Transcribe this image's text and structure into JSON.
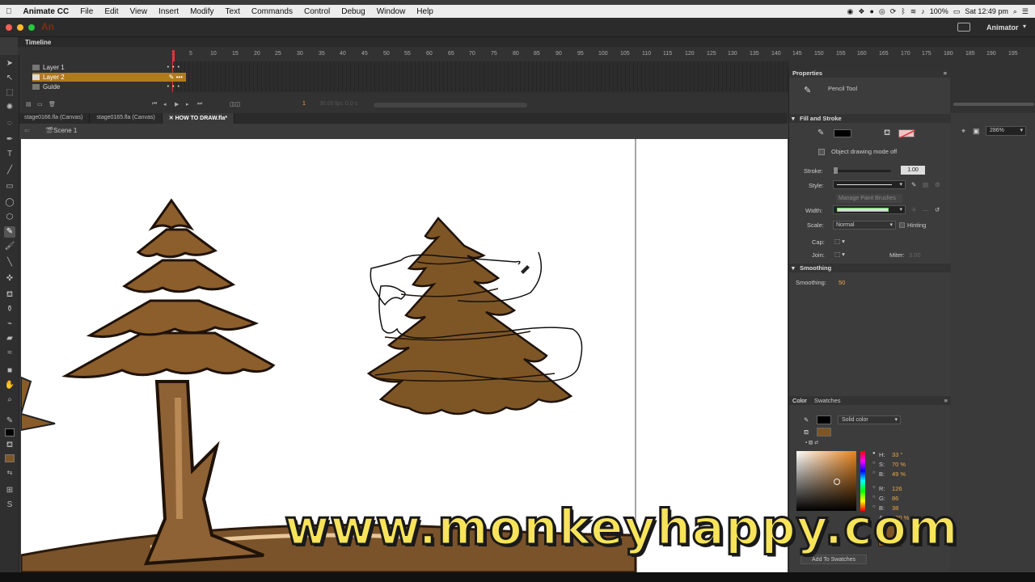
{
  "menubar": {
    "apple": "",
    "app_name": "Animate CC",
    "items": [
      "File",
      "Edit",
      "View",
      "Insert",
      "Modify",
      "Text",
      "Commands",
      "Control",
      "Debug",
      "Window",
      "Help"
    ],
    "battery": "100%",
    "clock": "Sat 12:49 pm"
  },
  "titlebar": {
    "logo": "An",
    "workspace": "Animator"
  },
  "timeline": {
    "title": "Timeline",
    "layers": [
      {
        "name": "Layer 1",
        "selected": false
      },
      {
        "name": "Layer 2",
        "selected": true
      },
      {
        "name": "Guide",
        "selected": false
      }
    ],
    "ruler_ticks": [
      "1",
      "5",
      "10",
      "15",
      "20",
      "25",
      "30",
      "35",
      "40",
      "45",
      "50",
      "55",
      "60",
      "65",
      "70",
      "75",
      "80",
      "85",
      "90",
      "95",
      "100",
      "105",
      "110",
      "115",
      "120",
      "125",
      "130",
      "135",
      "140",
      "145",
      "150",
      "155",
      "160",
      "165",
      "170",
      "175",
      "180",
      "185",
      "190",
      "195"
    ],
    "current_frame": "1",
    "fps": "30.00 fps",
    "time": "0.0 s"
  },
  "doc_tabs": [
    "stage0166.fla (Canvas)",
    "stage0165.fla (Canvas)",
    "HOW TO DRAW.fla*"
  ],
  "active_tab_index": 2,
  "scene": "Scene 1",
  "zoom": "286%",
  "properties": {
    "title": "Properties",
    "tool_name": "Pencil Tool",
    "fill_stroke_title": "Fill and Stroke",
    "object_drawing": "Object drawing mode off",
    "stroke_label": "Stroke:",
    "stroke_value": "1.00",
    "style_label": "Style:",
    "manage_brushes": "Manage Paint Brushes",
    "width_label": "Width:",
    "scale_label": "Scale:",
    "scale_value": "Normal",
    "hinting_label": "Hinting",
    "cap_label": "Cap:",
    "join_label": "Join:",
    "miter_label": "Miter:",
    "miter_value": "3.00",
    "smoothing_title": "Smoothing",
    "smoothing_label": "Smoothing:",
    "smoothing_value": "50"
  },
  "color_panel": {
    "tab_color": "Color",
    "tab_swatches": "Swatches",
    "type": "Solid color",
    "h_label": "H:",
    "h": "33 °",
    "s_label": "S:",
    "s": "70 %",
    "b_label": "B:",
    "b": "49 %",
    "r_label": "R:",
    "r": "126",
    "g_label": "G:",
    "g": "86",
    "bl_label": "B:",
    "bl": "38",
    "a_label": "A:",
    "a": "100 %",
    "add_swatch": "Add To Swatches",
    "fill_color": "#7e5626",
    "stroke_color": "#000000"
  },
  "watermark": "www.monkeyhappy.com"
}
